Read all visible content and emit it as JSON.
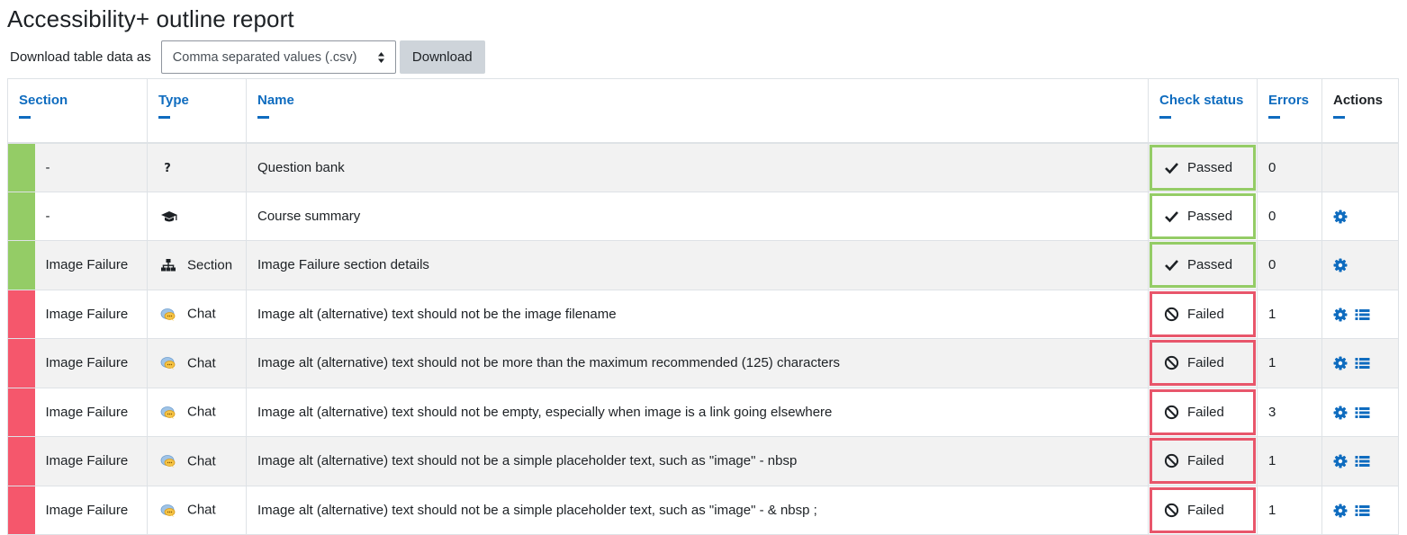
{
  "page": {
    "title": "Accessibility+ outline report"
  },
  "download": {
    "label": "Download table data as",
    "selected_format": "Comma separated values (.csv)",
    "button_label": "Download"
  },
  "table": {
    "columns": {
      "section": "Section",
      "type": "Type",
      "name": "Name",
      "check_status": "Check status",
      "errors": "Errors",
      "actions": "Actions"
    },
    "rows": [
      {
        "section": "-",
        "type_icon": "question-icon",
        "type": "",
        "name": "Question bank",
        "status": "Passed",
        "result": "pass",
        "errors": "0",
        "actions": []
      },
      {
        "section": "-",
        "type_icon": "graduation-cap-icon",
        "type": "",
        "name": "Course summary",
        "status": "Passed",
        "result": "pass",
        "errors": "0",
        "actions": [
          "settings"
        ]
      },
      {
        "section": "Image Failure",
        "type_icon": "sitemap-icon",
        "type": "Section",
        "name": "Image Failure section details",
        "status": "Passed",
        "result": "pass",
        "errors": "0",
        "actions": [
          "settings"
        ]
      },
      {
        "section": "Image Failure",
        "type_icon": "chat-icon",
        "type": "Chat",
        "name": "Image alt (alternative) text should not be the image filename",
        "status": "Failed",
        "result": "fail",
        "errors": "1",
        "actions": [
          "settings",
          "details"
        ]
      },
      {
        "section": "Image Failure",
        "type_icon": "chat-icon",
        "type": "Chat",
        "name": "Image alt (alternative) text should not be more than the maximum recommended (125) characters",
        "status": "Failed",
        "result": "fail",
        "errors": "1",
        "actions": [
          "settings",
          "details"
        ]
      },
      {
        "section": "Image Failure",
        "type_icon": "chat-icon",
        "type": "Chat",
        "name": "Image alt (alternative) text should not be empty, especially when image is a link going elsewhere",
        "status": "Failed",
        "result": "fail",
        "errors": "3",
        "actions": [
          "settings",
          "details"
        ]
      },
      {
        "section": "Image Failure",
        "type_icon": "chat-icon",
        "type": "Chat",
        "name": "Image alt (alternative) text should not be a simple placeholder text, such as \"image\" - nbsp",
        "status": "Failed",
        "result": "fail",
        "errors": "1",
        "actions": [
          "settings",
          "details"
        ]
      },
      {
        "section": "Image Failure",
        "type_icon": "chat-icon",
        "type": "Chat",
        "name": "Image alt (alternative) text should not be a simple placeholder text, such as \"image\" - & nbsp ;",
        "status": "Failed",
        "result": "fail",
        "errors": "1",
        "actions": [
          "settings",
          "details"
        ]
      }
    ]
  },
  "colors": {
    "pass": "#94cc66",
    "fail": "#f5576c",
    "link": "#0f6cbf"
  }
}
